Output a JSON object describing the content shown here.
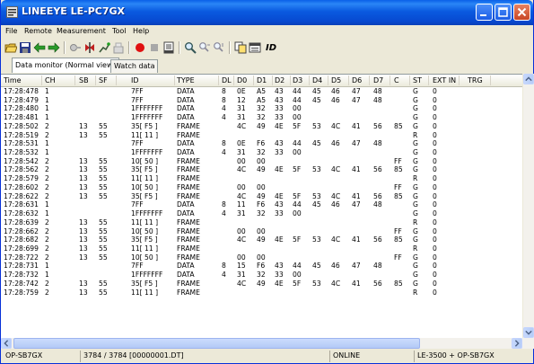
{
  "window": {
    "title": "LINEEYE LE-PC7GX"
  },
  "menu": {
    "items": [
      "File",
      "Remote",
      "Measurement",
      "Tool",
      "Help"
    ]
  },
  "toolbar": {
    "id_label": "ID"
  },
  "tabs": [
    {
      "label": "Data monitor (Normal view)",
      "active": true
    },
    {
      "label": "Watch data",
      "active": false
    }
  ],
  "table": {
    "columns": [
      "Time",
      "CH",
      "SB",
      "SF",
      "ID",
      "TYPE",
      "DL",
      "D0",
      "D1",
      "D2",
      "D3",
      "D4",
      "D5",
      "D6",
      "D7",
      "C",
      "ST",
      "EXT IN",
      "TRG"
    ],
    "rows": [
      [
        "17:28:478",
        "1",
        "",
        "",
        "7FF",
        "DATA",
        "8",
        "0E",
        "A5",
        "43",
        "44",
        "45",
        "46",
        "47",
        "48",
        "",
        "G",
        "0",
        ""
      ],
      [
        "17:28:479",
        "1",
        "",
        "",
        "7FF",
        "DATA",
        "8",
        "12",
        "A5",
        "43",
        "44",
        "45",
        "46",
        "47",
        "48",
        "",
        "G",
        "0",
        ""
      ],
      [
        "17:28:480",
        "1",
        "",
        "",
        "1FFFFFFF",
        "DATA",
        "4",
        "31",
        "32",
        "33",
        "00",
        "",
        "",
        "",
        "",
        "",
        "G",
        "0",
        ""
      ],
      [
        "17:28:481",
        "1",
        "",
        "",
        "1FFFFFFF",
        "DATA",
        "4",
        "31",
        "32",
        "33",
        "00",
        "",
        "",
        "",
        "",
        "",
        "G",
        "0",
        ""
      ],
      [
        "17:28:502",
        "2",
        "13",
        "55",
        "35[ F5 ]",
        "FRAME",
        "",
        "4C",
        "49",
        "4E",
        "5F",
        "53",
        "4C",
        "41",
        "56",
        "85",
        "G",
        "0",
        ""
      ],
      [
        "17:28:519",
        "2",
        "13",
        "55",
        "11[ 11 ]",
        "FRAME",
        "",
        "",
        "",
        "",
        "",
        "",
        "",
        "",
        "",
        "",
        "R",
        "0",
        ""
      ],
      [
        "17:28:531",
        "1",
        "",
        "",
        "7FF",
        "DATA",
        "8",
        "0E",
        "F6",
        "43",
        "44",
        "45",
        "46",
        "47",
        "48",
        "",
        "G",
        "0",
        ""
      ],
      [
        "17:28:532",
        "1",
        "",
        "",
        "1FFFFFFF",
        "DATA",
        "4",
        "31",
        "32",
        "33",
        "00",
        "",
        "",
        "",
        "",
        "",
        "G",
        "0",
        ""
      ],
      [
        "17:28:542",
        "2",
        "13",
        "55",
        "10[ 50 ]",
        "FRAME",
        "",
        "00",
        "00",
        "",
        "",
        "",
        "",
        "",
        "",
        "FF",
        "G",
        "0",
        ""
      ],
      [
        "17:28:562",
        "2",
        "13",
        "55",
        "35[ F5 ]",
        "FRAME",
        "",
        "4C",
        "49",
        "4E",
        "5F",
        "53",
        "4C",
        "41",
        "56",
        "85",
        "G",
        "0",
        ""
      ],
      [
        "17:28:579",
        "2",
        "13",
        "55",
        "11[ 11 ]",
        "FRAME",
        "",
        "",
        "",
        "",
        "",
        "",
        "",
        "",
        "",
        "",
        "R",
        "0",
        ""
      ],
      [
        "17:28:602",
        "2",
        "13",
        "55",
        "10[ 50 ]",
        "FRAME",
        "",
        "00",
        "00",
        "",
        "",
        "",
        "",
        "",
        "",
        "FF",
        "G",
        "0",
        ""
      ],
      [
        "17:28:622",
        "2",
        "13",
        "55",
        "35[ F5 ]",
        "FRAME",
        "",
        "4C",
        "49",
        "4E",
        "5F",
        "53",
        "4C",
        "41",
        "56",
        "85",
        "G",
        "0",
        ""
      ],
      [
        "17:28:631",
        "1",
        "",
        "",
        "7FF",
        "DATA",
        "8",
        "11",
        "F6",
        "43",
        "44",
        "45",
        "46",
        "47",
        "48",
        "",
        "G",
        "0",
        ""
      ],
      [
        "17:28:632",
        "1",
        "",
        "",
        "1FFFFFFF",
        "DATA",
        "4",
        "31",
        "32",
        "33",
        "00",
        "",
        "",
        "",
        "",
        "",
        "G",
        "0",
        ""
      ],
      [
        "17:28:639",
        "2",
        "13",
        "55",
        "11[ 11 ]",
        "FRAME",
        "",
        "",
        "",
        "",
        "",
        "",
        "",
        "",
        "",
        "",
        "R",
        "0",
        ""
      ],
      [
        "17:28:662",
        "2",
        "13",
        "55",
        "10[ 50 ]",
        "FRAME",
        "",
        "00",
        "00",
        "",
        "",
        "",
        "",
        "",
        "",
        "FF",
        "G",
        "0",
        ""
      ],
      [
        "17:28:682",
        "2",
        "13",
        "55",
        "35[ F5 ]",
        "FRAME",
        "",
        "4C",
        "49",
        "4E",
        "5F",
        "53",
        "4C",
        "41",
        "56",
        "85",
        "G",
        "0",
        ""
      ],
      [
        "17:28:699",
        "2",
        "13",
        "55",
        "11[ 11 ]",
        "FRAME",
        "",
        "",
        "",
        "",
        "",
        "",
        "",
        "",
        "",
        "",
        "R",
        "0",
        ""
      ],
      [
        "17:28:722",
        "2",
        "13",
        "55",
        "10[ 50 ]",
        "FRAME",
        "",
        "00",
        "00",
        "",
        "",
        "",
        "",
        "",
        "",
        "FF",
        "G",
        "0",
        ""
      ],
      [
        "17:28:731",
        "1",
        "",
        "",
        "7FF",
        "DATA",
        "8",
        "15",
        "F6",
        "43",
        "44",
        "45",
        "46",
        "47",
        "48",
        "",
        "G",
        "0",
        ""
      ],
      [
        "17:28:732",
        "1",
        "",
        "",
        "1FFFFFFF",
        "DATA",
        "4",
        "31",
        "32",
        "33",
        "00",
        "",
        "",
        "",
        "",
        "",
        "G",
        "0",
        ""
      ],
      [
        "17:28:742",
        "2",
        "13",
        "55",
        "35[ F5 ]",
        "FRAME",
        "",
        "4C",
        "49",
        "4E",
        "5F",
        "53",
        "4C",
        "41",
        "56",
        "85",
        "G",
        "0",
        ""
      ],
      [
        "17:28:759",
        "2",
        "13",
        "55",
        "11[ 11 ]",
        "FRAME",
        "",
        "",
        "",
        "",
        "",
        "",
        "",
        "",
        "",
        "",
        "R",
        "0",
        ""
      ]
    ]
  },
  "statusbar": {
    "port": "OP-SB7GX",
    "record": "3784 / 3784 [00000001.DT]",
    "state": "ONLINE",
    "device": "LE-3500 + OP-SB7GX"
  },
  "colors": {
    "titlebar": "#0a5ae0",
    "record_red": "#e01010",
    "grid_bg": "#ffffff"
  }
}
